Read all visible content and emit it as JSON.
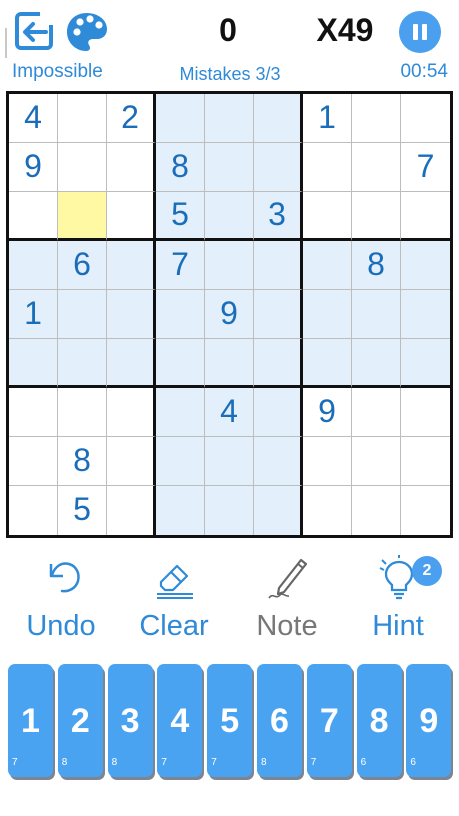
{
  "header": {
    "difficulty": "Impossible",
    "score": "0",
    "multiplier": "X49",
    "mistakes": "Mistakes 3/3",
    "timer": "00:54",
    "icons": {
      "exit": "exit-icon",
      "palette": "palette-icon",
      "pause": "pause-icon"
    }
  },
  "colors": {
    "accent": "#2f8ad8",
    "key": "#4aa3f1",
    "highlight": "#e3effb",
    "selected": "#fff9a3",
    "given_digit": "#1a6db8"
  },
  "board": {
    "selected_cell": {
      "row": 2,
      "col": 1
    },
    "cells": [
      [
        "4",
        "",
        "2",
        "",
        "",
        "",
        "1",
        "",
        ""
      ],
      [
        "9",
        "",
        "",
        "8",
        "",
        "",
        "",
        "",
        "7"
      ],
      [
        "",
        "",
        "",
        "5",
        "",
        "3",
        "",
        "",
        ""
      ],
      [
        "",
        "6",
        "",
        "7",
        "",
        "",
        "",
        "8",
        ""
      ],
      [
        "1",
        "",
        "",
        "",
        "9",
        "",
        "",
        "",
        ""
      ],
      [
        "",
        "",
        "",
        "",
        "",
        "",
        "",
        "",
        ""
      ],
      [
        "",
        "",
        "",
        "",
        "4",
        "",
        "9",
        "",
        ""
      ],
      [
        "",
        "8",
        "",
        "",
        "",
        "",
        "",
        "",
        ""
      ],
      [
        "",
        "5",
        "",
        "",
        "",
        "",
        "",
        "",
        ""
      ]
    ]
  },
  "tools": {
    "undo": "Undo",
    "clear": "Clear",
    "note": "Note",
    "hint": "Hint",
    "hint_count": "2"
  },
  "numpad": [
    {
      "digit": "1",
      "remaining": "7"
    },
    {
      "digit": "2",
      "remaining": "8"
    },
    {
      "digit": "3",
      "remaining": "8"
    },
    {
      "digit": "4",
      "remaining": "7"
    },
    {
      "digit": "5",
      "remaining": "7"
    },
    {
      "digit": "6",
      "remaining": "8"
    },
    {
      "digit": "7",
      "remaining": "7"
    },
    {
      "digit": "8",
      "remaining": "6"
    },
    {
      "digit": "9",
      "remaining": "6"
    }
  ]
}
